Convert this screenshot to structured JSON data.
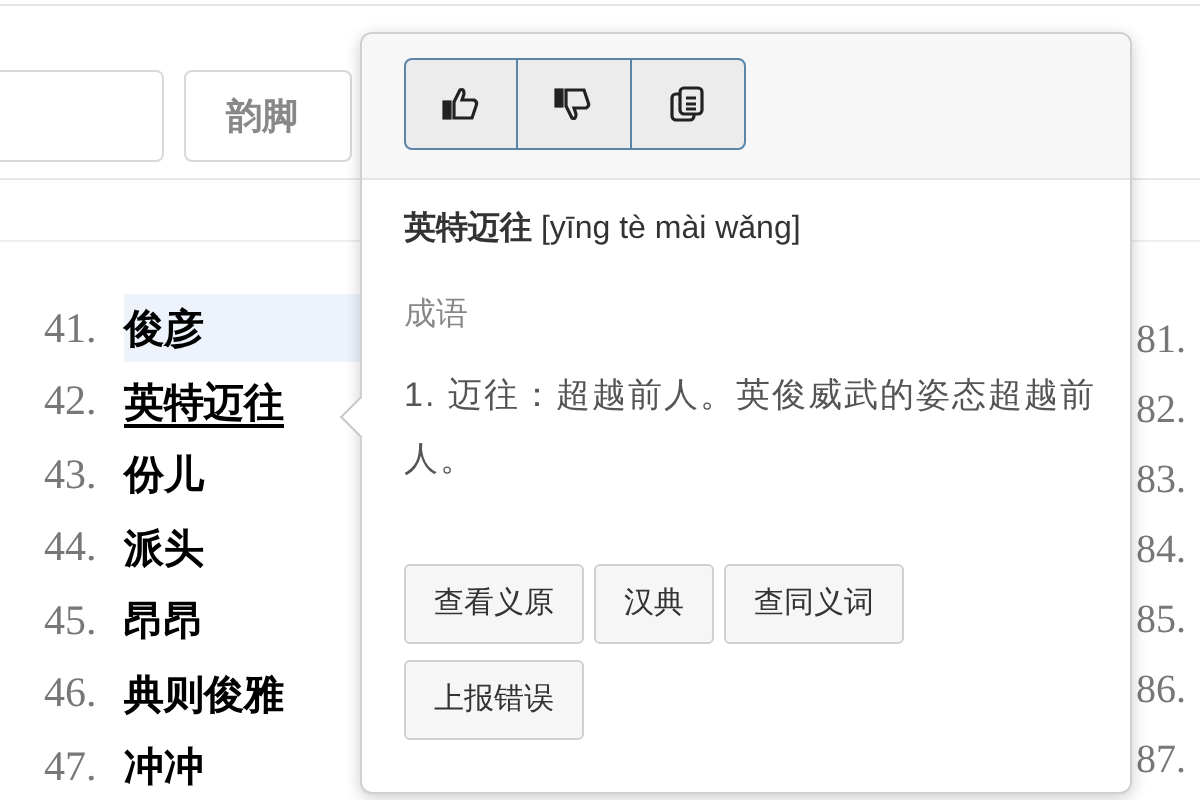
{
  "rhyme_button": "韵脚",
  "word_list": [
    {
      "number": "41.",
      "word": "俊彦",
      "selected": true,
      "hovered": false
    },
    {
      "number": "42.",
      "word": "英特迈往",
      "selected": false,
      "hovered": true
    },
    {
      "number": "43.",
      "word": "份儿",
      "selected": false,
      "hovered": false
    },
    {
      "number": "44.",
      "word": "派头",
      "selected": false,
      "hovered": false
    },
    {
      "number": "45.",
      "word": "昂昂",
      "selected": false,
      "hovered": false
    },
    {
      "number": "46.",
      "word": "典则俊雅",
      "selected": false,
      "hovered": false
    },
    {
      "number": "47.",
      "word": "冲冲",
      "selected": false,
      "hovered": false
    }
  ],
  "right_numbers": [
    "81.",
    "82.",
    "83.",
    "84.",
    "85.",
    "86.",
    "87."
  ],
  "popup": {
    "word": "英特迈往",
    "pinyin": "[yīng tè mài wǎng]",
    "category": "成语",
    "definition": "1. 迈往：超越前人。英俊威武的姿态超越前人。",
    "actions": [
      "查看义原",
      "汉典",
      "查同义词",
      "上报错误"
    ]
  }
}
